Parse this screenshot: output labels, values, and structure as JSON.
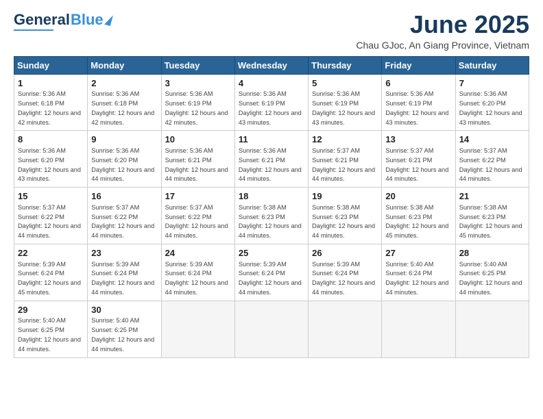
{
  "header": {
    "logo_general": "General",
    "logo_blue": "Blue",
    "month_title": "June 2025",
    "location": "Chau GJoc, An Giang Province, Vietnam"
  },
  "days_of_week": [
    "Sunday",
    "Monday",
    "Tuesday",
    "Wednesday",
    "Thursday",
    "Friday",
    "Saturday"
  ],
  "weeks": [
    [
      {
        "day": "1",
        "sunrise": "5:36 AM",
        "sunset": "6:18 PM",
        "daylight": "12 hours and 42 minutes."
      },
      {
        "day": "2",
        "sunrise": "5:36 AM",
        "sunset": "6:18 PM",
        "daylight": "12 hours and 42 minutes."
      },
      {
        "day": "3",
        "sunrise": "5:36 AM",
        "sunset": "6:19 PM",
        "daylight": "12 hours and 42 minutes."
      },
      {
        "day": "4",
        "sunrise": "5:36 AM",
        "sunset": "6:19 PM",
        "daylight": "12 hours and 43 minutes."
      },
      {
        "day": "5",
        "sunrise": "5:36 AM",
        "sunset": "6:19 PM",
        "daylight": "12 hours and 43 minutes."
      },
      {
        "day": "6",
        "sunrise": "5:36 AM",
        "sunset": "6:19 PM",
        "daylight": "12 hours and 43 minutes."
      },
      {
        "day": "7",
        "sunrise": "5:36 AM",
        "sunset": "6:20 PM",
        "daylight": "12 hours and 43 minutes."
      }
    ],
    [
      {
        "day": "8",
        "sunrise": "5:36 AM",
        "sunset": "6:20 PM",
        "daylight": "12 hours and 43 minutes."
      },
      {
        "day": "9",
        "sunrise": "5:36 AM",
        "sunset": "6:20 PM",
        "daylight": "12 hours and 44 minutes."
      },
      {
        "day": "10",
        "sunrise": "5:36 AM",
        "sunset": "6:21 PM",
        "daylight": "12 hours and 44 minutes."
      },
      {
        "day": "11",
        "sunrise": "5:36 AM",
        "sunset": "6:21 PM",
        "daylight": "12 hours and 44 minutes."
      },
      {
        "day": "12",
        "sunrise": "5:37 AM",
        "sunset": "6:21 PM",
        "daylight": "12 hours and 44 minutes."
      },
      {
        "day": "13",
        "sunrise": "5:37 AM",
        "sunset": "6:21 PM",
        "daylight": "12 hours and 44 minutes."
      },
      {
        "day": "14",
        "sunrise": "5:37 AM",
        "sunset": "6:22 PM",
        "daylight": "12 hours and 44 minutes."
      }
    ],
    [
      {
        "day": "15",
        "sunrise": "5:37 AM",
        "sunset": "6:22 PM",
        "daylight": "12 hours and 44 minutes."
      },
      {
        "day": "16",
        "sunrise": "5:37 AM",
        "sunset": "6:22 PM",
        "daylight": "12 hours and 44 minutes."
      },
      {
        "day": "17",
        "sunrise": "5:37 AM",
        "sunset": "6:22 PM",
        "daylight": "12 hours and 44 minutes."
      },
      {
        "day": "18",
        "sunrise": "5:38 AM",
        "sunset": "6:23 PM",
        "daylight": "12 hours and 44 minutes."
      },
      {
        "day": "19",
        "sunrise": "5:38 AM",
        "sunset": "6:23 PM",
        "daylight": "12 hours and 44 minutes."
      },
      {
        "day": "20",
        "sunrise": "5:38 AM",
        "sunset": "6:23 PM",
        "daylight": "12 hours and 45 minutes."
      },
      {
        "day": "21",
        "sunrise": "5:38 AM",
        "sunset": "6:23 PM",
        "daylight": "12 hours and 45 minutes."
      }
    ],
    [
      {
        "day": "22",
        "sunrise": "5:39 AM",
        "sunset": "6:24 PM",
        "daylight": "12 hours and 45 minutes."
      },
      {
        "day": "23",
        "sunrise": "5:39 AM",
        "sunset": "6:24 PM",
        "daylight": "12 hours and 44 minutes."
      },
      {
        "day": "24",
        "sunrise": "5:39 AM",
        "sunset": "6:24 PM",
        "daylight": "12 hours and 44 minutes."
      },
      {
        "day": "25",
        "sunrise": "5:39 AM",
        "sunset": "6:24 PM",
        "daylight": "12 hours and 44 minutes."
      },
      {
        "day": "26",
        "sunrise": "5:39 AM",
        "sunset": "6:24 PM",
        "daylight": "12 hours and 44 minutes."
      },
      {
        "day": "27",
        "sunrise": "5:40 AM",
        "sunset": "6:24 PM",
        "daylight": "12 hours and 44 minutes."
      },
      {
        "day": "28",
        "sunrise": "5:40 AM",
        "sunset": "6:25 PM",
        "daylight": "12 hours and 44 minutes."
      }
    ],
    [
      {
        "day": "29",
        "sunrise": "5:40 AM",
        "sunset": "6:25 PM",
        "daylight": "12 hours and 44 minutes."
      },
      {
        "day": "30",
        "sunrise": "5:40 AM",
        "sunset": "6:25 PM",
        "daylight": "12 hours and 44 minutes."
      },
      null,
      null,
      null,
      null,
      null
    ]
  ]
}
